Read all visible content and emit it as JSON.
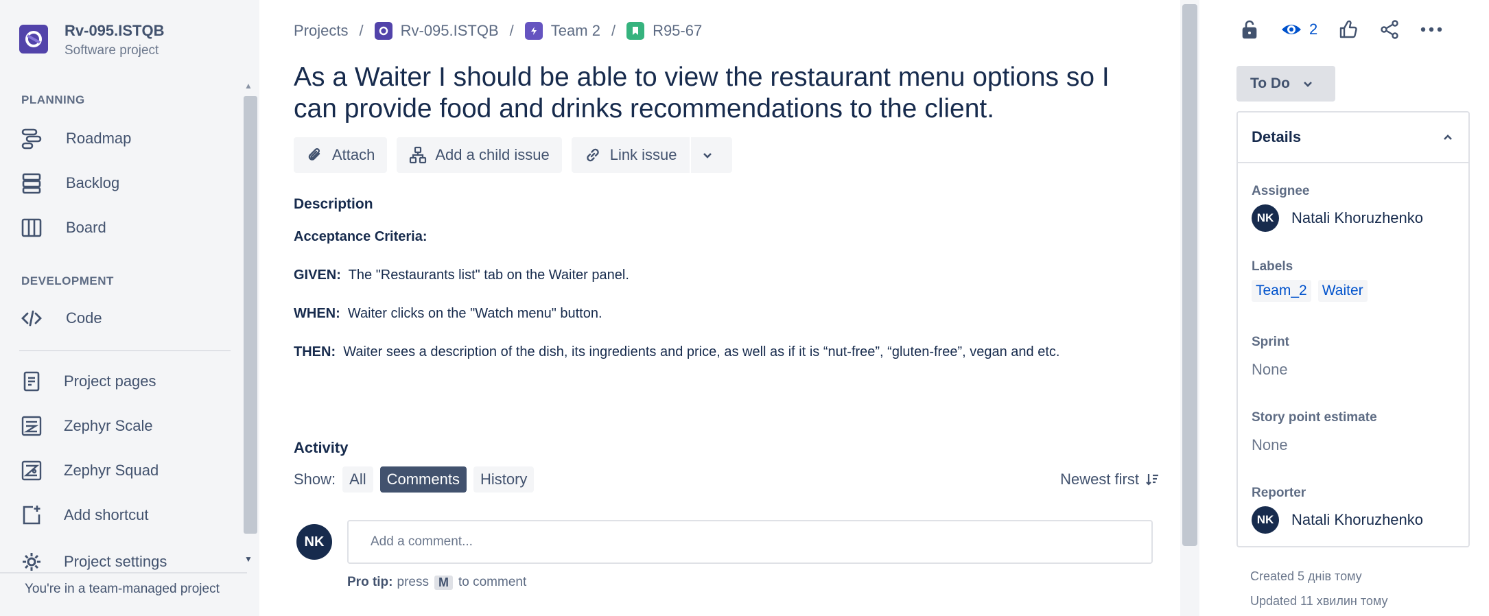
{
  "project": {
    "name": "Rv-095.ISTQB",
    "type": "Software project"
  },
  "sidebar": {
    "planning_heading": "PLANNING",
    "development_heading": "DEVELOPMENT",
    "items": [
      {
        "label": "Roadmap",
        "icon": "roadmap-icon"
      },
      {
        "label": "Backlog",
        "icon": "backlog-icon"
      },
      {
        "label": "Board",
        "icon": "board-icon"
      },
      {
        "label": "Code",
        "icon": "code-icon"
      },
      {
        "label": "Project pages",
        "icon": "pages-icon"
      },
      {
        "label": "Zephyr Scale",
        "icon": "zephyr-scale-icon"
      },
      {
        "label": "Zephyr Squad",
        "icon": "zephyr-squad-icon"
      },
      {
        "label": "Add shortcut",
        "icon": "add-shortcut-icon"
      },
      {
        "label": "Project settings",
        "icon": "gear-icon"
      }
    ],
    "footer_note": "You're in a team-managed project"
  },
  "breadcrumb": {
    "projects": "Projects",
    "project": "Rv-095.ISTQB",
    "epic": "Team 2",
    "issue": "R95-67"
  },
  "issue": {
    "title": "As a Waiter I should be able to view the restaurant menu options so I can provide food and drinks recommendations to the client.",
    "toolbar": {
      "attach": "Attach",
      "add_child": "Add a child issue",
      "link_issue": "Link issue"
    },
    "description_heading": "Description",
    "description": {
      "acceptance": "Acceptance Criteria:",
      "given_label": "GIVEN:",
      "given_text": "The \"Restaurants list\"  tab on the Waiter panel.",
      "when_label": "WHEN:",
      "when_text": "Waiter clicks on the \"Watch menu\" button.",
      "then_label": "THEN:",
      "then_text": "Waiter sees a description of the dish, its ingredients and price, as well as if it is “nut-free”, “gluten-free”, vegan and etc."
    }
  },
  "activity": {
    "heading": "Activity",
    "show_label": "Show:",
    "filters": [
      "All",
      "Comments",
      "History"
    ],
    "active_filter": "Comments",
    "sort": "Newest first",
    "comment_placeholder": "Add a comment...",
    "user_initials": "NK",
    "protip_label": "Pro tip:",
    "protip_press": "press",
    "protip_key": "M",
    "protip_rest": "to comment"
  },
  "right_panel": {
    "watch_count": "2",
    "status": "To Do",
    "details_heading": "Details",
    "assignee_label": "Assignee",
    "assignee": "Natali Khoruzhenko",
    "labels_label": "Labels",
    "labels": [
      "Team_2",
      "Waiter"
    ],
    "sprint_label": "Sprint",
    "sprint": "None",
    "story_points_label": "Story point estimate",
    "story_points": "None",
    "reporter_label": "Reporter",
    "reporter": "Natali Khoruzhenko",
    "created": "Created 5 днів тому",
    "updated": "Updated 11 хвилин тому"
  },
  "colors": {
    "accent": "#0052CC",
    "project_avatar": "#5243AA",
    "text": "#172B4D",
    "active_filter": "#42526E"
  }
}
